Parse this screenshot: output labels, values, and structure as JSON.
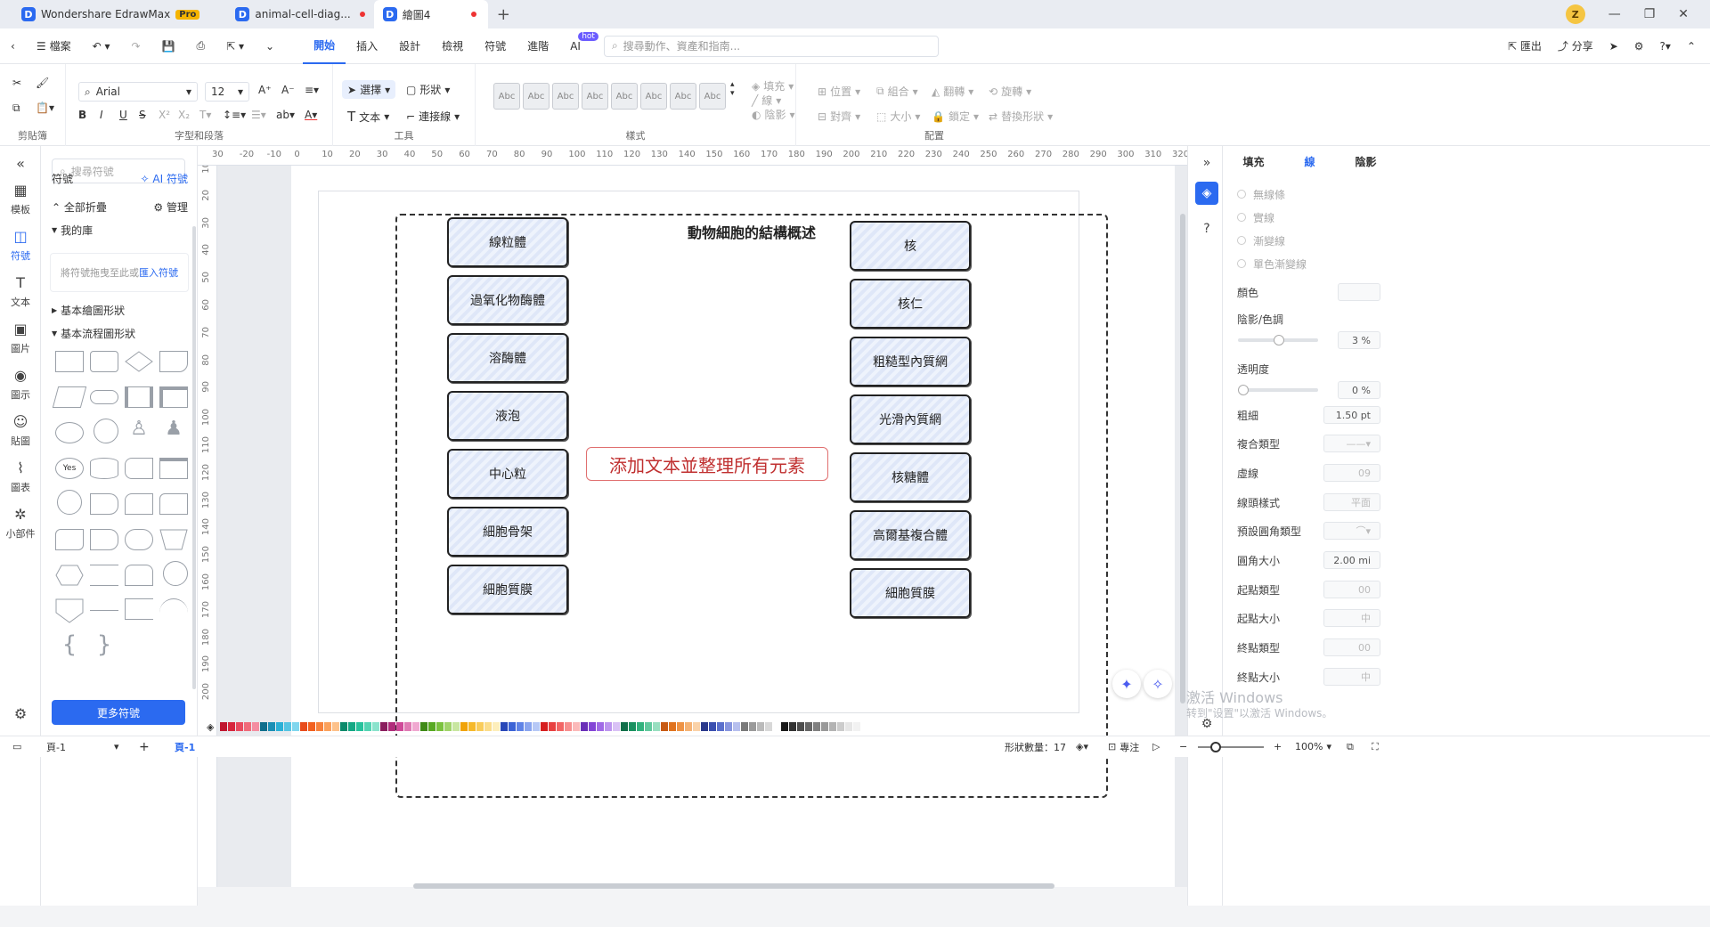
{
  "titlebar": {
    "tabs": [
      {
        "label": "Wondershare EdrawMax",
        "badge": "Pro"
      },
      {
        "label": "animal-cell-diag..."
      },
      {
        "label": "繪圖4"
      }
    ],
    "new_tab": "+",
    "avatar": "Z"
  },
  "menubar": {
    "file": "檔案",
    "tabs": [
      "開始",
      "插入",
      "設計",
      "檢視",
      "符號",
      "進階",
      "AI"
    ],
    "ai_badge": "hot",
    "search_placeholder": "搜尋動作、資產和指南...",
    "export": "匯出",
    "share": "分享"
  },
  "ribbon": {
    "clipboard_label": "剪貼簿",
    "font_name": "Arial",
    "font_size": "12",
    "font_group_label": "字型和段落",
    "select_label": "選擇",
    "shape_label": "形狀",
    "text_label": "文本",
    "connector_label": "連接線",
    "tools_label": "工具",
    "style_sample": "Abc",
    "style_label": "樣式",
    "fill": "填充",
    "line": "線",
    "shadow": "陰影",
    "position": "位置",
    "group": "組合",
    "flip": "翻轉",
    "rotate": "旋轉",
    "align": "對齊",
    "size": "大小",
    "lock": "鎖定",
    "replace_shape": "替換形狀",
    "arrange_label": "配置"
  },
  "leftbar": [
    "模板",
    "符號",
    "文本",
    "圖片",
    "圖示",
    "貼圖",
    "圖表",
    "小部件"
  ],
  "sympanel": {
    "search_placeholder": "搜尋符號",
    "title": "符號",
    "ai_symbols": "AI 符號",
    "collapse_all": "全部折疊",
    "manage": "管理",
    "my_library": "我的庫",
    "drop_hint": "將符號拖曳至此或",
    "import_link": "匯入符號",
    "basic_shapes": "基本繪圖形狀",
    "basic_flow": "基本流程圖形狀",
    "yes_shape": "Yes",
    "more_button": "更多符號"
  },
  "ruler": {
    "h": [
      "30",
      "-20",
      "-10",
      "0",
      "10",
      "20",
      "30",
      "40",
      "50",
      "60",
      "70",
      "80",
      "90",
      "100",
      "110",
      "120",
      "130",
      "140",
      "150",
      "160",
      "170",
      "180",
      "190",
      "200",
      "210",
      "220",
      "230",
      "240",
      "250",
      "260",
      "270",
      "280",
      "290",
      "300",
      "310",
      "320"
    ],
    "v": [
      "10",
      "20",
      "30",
      "40",
      "50",
      "60",
      "70",
      "80",
      "90",
      "100",
      "110",
      "120",
      "130",
      "140",
      "150",
      "160",
      "170",
      "180",
      "190",
      "200"
    ]
  },
  "diagram": {
    "title": "動物細胞的結構概述",
    "left": [
      "線粒體",
      "過氧化物酶體",
      "溶酶體",
      "液泡",
      "中心粒",
      "細胞骨架",
      "細胞質膜"
    ],
    "right": [
      "核",
      "核仁",
      "粗糙型內質網",
      "光滑內質網",
      "核糖體",
      "高爾基複合體",
      "細胞質膜"
    ],
    "center_text": "添加文本並整理所有元素"
  },
  "rightpanel": {
    "tabs": [
      "填充",
      "線",
      "陰影"
    ],
    "line_options": [
      "無線條",
      "實線",
      "漸變線",
      "單色漸變線"
    ],
    "color": "顏色",
    "shade": "陰影/色調",
    "shade_value": "3 %",
    "transparency": "透明度",
    "transparency_value": "0 %",
    "weight": "粗細",
    "weight_value": "1.50 pt",
    "compound": "複合類型",
    "dash": "虛線",
    "dash_value": "09",
    "cap": "線頭樣式",
    "cap_value": "平面",
    "corner_type": "預設圓角類型",
    "corner_size": "圓角大小",
    "corner_value": "2.00 mi",
    "start_type": "起點類型",
    "start_type_value": "00",
    "start_size": "起點大小",
    "start_size_value": "中",
    "end_type": "終點類型",
    "end_type_value": "00",
    "end_size": "終點大小",
    "end_size_value": "中"
  },
  "watermark": {
    "line1": "激活 Windows",
    "line2": "转到\"设置\"以激活 Windows。"
  },
  "statusbar": {
    "page_select": "頁-1",
    "page_tab": "頁-1",
    "add": "+",
    "shape_count": "形狀數量：17",
    "focus": "專注",
    "zoom": "100%"
  },
  "colors": {
    "accent": "#2b6af0",
    "palette": [
      "#c0152f",
      "#d7263d",
      "#e84a5f",
      "#f06a7a",
      "#f48ca0",
      "#0f6e8c",
      "#1a8fb5",
      "#2bb0d6",
      "#55c4e3",
      "#7fd6ee",
      "#e84c1c",
      "#f2601f",
      "#f7813b",
      "#fba15c",
      "#fdc18a",
      "#0c8a6b",
      "#14a884",
      "#27c29c",
      "#54d4b3",
      "#8ae3cc",
      "#8a1f5e",
      "#b02c7a",
      "#cf4a98",
      "#e07bb4",
      "#f0a8d0",
      "#3f8a17",
      "#58a923",
      "#7bc23f",
      "#a1d46b",
      "#c8e6a0",
      "#f0a30a",
      "#f6b92b",
      "#f9cc5b",
      "#fbdd8b",
      "#fdeebb",
      "#2948b8",
      "#3b63d6",
      "#5f83e6",
      "#8aa5ef",
      "#b6c8f6",
      "#d61f1f",
      "#e84141",
      "#f26565",
      "#f78f8f",
      "#fbb9b9",
      "#6a2fb8",
      "#8345d6",
      "#a06ae6",
      "#bd95ef",
      "#d9c1f6",
      "#11704a",
      "#1a9160",
      "#32b27d",
      "#62c99e",
      "#98dfc0",
      "#c85a14",
      "#e0731f",
      "#ee9345",
      "#f5b375",
      "#fad2a8",
      "#2b3a8c",
      "#3a4fb0",
      "#5a6fcc",
      "#8795df",
      "#b6bfee",
      "#7a7a7a",
      "#9a9a9a",
      "#bababa",
      "#d8d8d8",
      "#ffffff",
      "#1a1a1a",
      "#333333",
      "#4d4d4d",
      "#666666",
      "#808080",
      "#999999",
      "#b3b3b3",
      "#cccccc",
      "#e6e6e6",
      "#f2f2f2"
    ]
  }
}
